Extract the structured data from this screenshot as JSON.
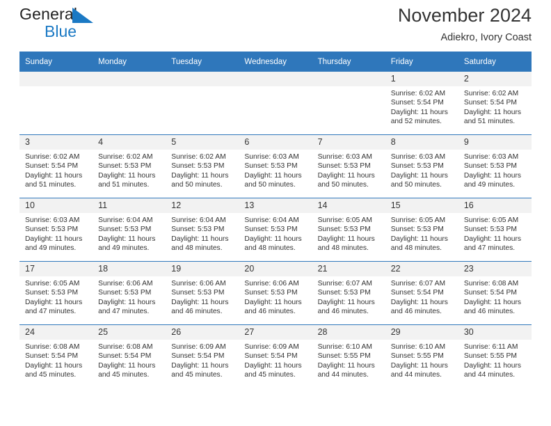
{
  "brand": {
    "word1": "General",
    "word2": "Blue",
    "flag_color": "#1b79c4",
    "text_color": "#222222"
  },
  "header": {
    "title": "November 2024",
    "subtitle": "Adiekro, Ivory Coast"
  },
  "theme": {
    "header_bg": "#2f77bb",
    "header_text": "#ffffff",
    "daynum_bg": "#f2f2f2",
    "cell_bg": "#ffffff",
    "text": "#333333"
  },
  "weekdays": [
    "Sunday",
    "Monday",
    "Tuesday",
    "Wednesday",
    "Thursday",
    "Friday",
    "Saturday"
  ],
  "labels": {
    "sunrise": "Sunrise:",
    "sunset": "Sunset:",
    "daylight": "Daylight:"
  },
  "weeks": [
    [
      {
        "day": "",
        "empty": true
      },
      {
        "day": "",
        "empty": true
      },
      {
        "day": "",
        "empty": true
      },
      {
        "day": "",
        "empty": true
      },
      {
        "day": "",
        "empty": true
      },
      {
        "day": "1",
        "sunrise": "Sunrise: 6:02 AM",
        "sunset": "Sunset: 5:54 PM",
        "daylight": "Daylight: 11 hours and 52 minutes."
      },
      {
        "day": "2",
        "sunrise": "Sunrise: 6:02 AM",
        "sunset": "Sunset: 5:54 PM",
        "daylight": "Daylight: 11 hours and 51 minutes."
      }
    ],
    [
      {
        "day": "3",
        "sunrise": "Sunrise: 6:02 AM",
        "sunset": "Sunset: 5:54 PM",
        "daylight": "Daylight: 11 hours and 51 minutes."
      },
      {
        "day": "4",
        "sunrise": "Sunrise: 6:02 AM",
        "sunset": "Sunset: 5:53 PM",
        "daylight": "Daylight: 11 hours and 51 minutes."
      },
      {
        "day": "5",
        "sunrise": "Sunrise: 6:02 AM",
        "sunset": "Sunset: 5:53 PM",
        "daylight": "Daylight: 11 hours and 50 minutes."
      },
      {
        "day": "6",
        "sunrise": "Sunrise: 6:03 AM",
        "sunset": "Sunset: 5:53 PM",
        "daylight": "Daylight: 11 hours and 50 minutes."
      },
      {
        "day": "7",
        "sunrise": "Sunrise: 6:03 AM",
        "sunset": "Sunset: 5:53 PM",
        "daylight": "Daylight: 11 hours and 50 minutes."
      },
      {
        "day": "8",
        "sunrise": "Sunrise: 6:03 AM",
        "sunset": "Sunset: 5:53 PM",
        "daylight": "Daylight: 11 hours and 50 minutes."
      },
      {
        "day": "9",
        "sunrise": "Sunrise: 6:03 AM",
        "sunset": "Sunset: 5:53 PM",
        "daylight": "Daylight: 11 hours and 49 minutes."
      }
    ],
    [
      {
        "day": "10",
        "sunrise": "Sunrise: 6:03 AM",
        "sunset": "Sunset: 5:53 PM",
        "daylight": "Daylight: 11 hours and 49 minutes."
      },
      {
        "day": "11",
        "sunrise": "Sunrise: 6:04 AM",
        "sunset": "Sunset: 5:53 PM",
        "daylight": "Daylight: 11 hours and 49 minutes."
      },
      {
        "day": "12",
        "sunrise": "Sunrise: 6:04 AM",
        "sunset": "Sunset: 5:53 PM",
        "daylight": "Daylight: 11 hours and 48 minutes."
      },
      {
        "day": "13",
        "sunrise": "Sunrise: 6:04 AM",
        "sunset": "Sunset: 5:53 PM",
        "daylight": "Daylight: 11 hours and 48 minutes."
      },
      {
        "day": "14",
        "sunrise": "Sunrise: 6:05 AM",
        "sunset": "Sunset: 5:53 PM",
        "daylight": "Daylight: 11 hours and 48 minutes."
      },
      {
        "day": "15",
        "sunrise": "Sunrise: 6:05 AM",
        "sunset": "Sunset: 5:53 PM",
        "daylight": "Daylight: 11 hours and 48 minutes."
      },
      {
        "day": "16",
        "sunrise": "Sunrise: 6:05 AM",
        "sunset": "Sunset: 5:53 PM",
        "daylight": "Daylight: 11 hours and 47 minutes."
      }
    ],
    [
      {
        "day": "17",
        "sunrise": "Sunrise: 6:05 AM",
        "sunset": "Sunset: 5:53 PM",
        "daylight": "Daylight: 11 hours and 47 minutes."
      },
      {
        "day": "18",
        "sunrise": "Sunrise: 6:06 AM",
        "sunset": "Sunset: 5:53 PM",
        "daylight": "Daylight: 11 hours and 47 minutes."
      },
      {
        "day": "19",
        "sunrise": "Sunrise: 6:06 AM",
        "sunset": "Sunset: 5:53 PM",
        "daylight": "Daylight: 11 hours and 46 minutes."
      },
      {
        "day": "20",
        "sunrise": "Sunrise: 6:06 AM",
        "sunset": "Sunset: 5:53 PM",
        "daylight": "Daylight: 11 hours and 46 minutes."
      },
      {
        "day": "21",
        "sunrise": "Sunrise: 6:07 AM",
        "sunset": "Sunset: 5:53 PM",
        "daylight": "Daylight: 11 hours and 46 minutes."
      },
      {
        "day": "22",
        "sunrise": "Sunrise: 6:07 AM",
        "sunset": "Sunset: 5:54 PM",
        "daylight": "Daylight: 11 hours and 46 minutes."
      },
      {
        "day": "23",
        "sunrise": "Sunrise: 6:08 AM",
        "sunset": "Sunset: 5:54 PM",
        "daylight": "Daylight: 11 hours and 46 minutes."
      }
    ],
    [
      {
        "day": "24",
        "sunrise": "Sunrise: 6:08 AM",
        "sunset": "Sunset: 5:54 PM",
        "daylight": "Daylight: 11 hours and 45 minutes."
      },
      {
        "day": "25",
        "sunrise": "Sunrise: 6:08 AM",
        "sunset": "Sunset: 5:54 PM",
        "daylight": "Daylight: 11 hours and 45 minutes."
      },
      {
        "day": "26",
        "sunrise": "Sunrise: 6:09 AM",
        "sunset": "Sunset: 5:54 PM",
        "daylight": "Daylight: 11 hours and 45 minutes."
      },
      {
        "day": "27",
        "sunrise": "Sunrise: 6:09 AM",
        "sunset": "Sunset: 5:54 PM",
        "daylight": "Daylight: 11 hours and 45 minutes."
      },
      {
        "day": "28",
        "sunrise": "Sunrise: 6:10 AM",
        "sunset": "Sunset: 5:55 PM",
        "daylight": "Daylight: 11 hours and 44 minutes."
      },
      {
        "day": "29",
        "sunrise": "Sunrise: 6:10 AM",
        "sunset": "Sunset: 5:55 PM",
        "daylight": "Daylight: 11 hours and 44 minutes."
      },
      {
        "day": "30",
        "sunrise": "Sunrise: 6:11 AM",
        "sunset": "Sunset: 5:55 PM",
        "daylight": "Daylight: 11 hours and 44 minutes."
      }
    ]
  ]
}
